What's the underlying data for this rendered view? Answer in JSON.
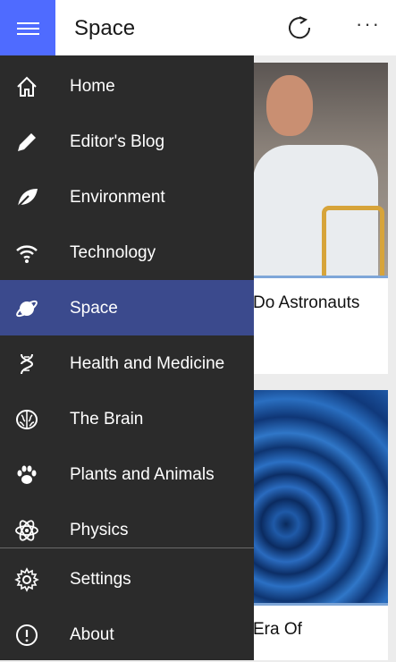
{
  "header": {
    "title": "Space",
    "menu_icon": "hamburger-icon",
    "refresh_icon": "refresh-icon",
    "more_label": "···"
  },
  "content": {
    "cards": [
      {
        "caption": "Do Astronauts"
      },
      {
        "caption": "Era Of"
      }
    ]
  },
  "nav": {
    "items": [
      {
        "label": "Home",
        "icon": "home-icon"
      },
      {
        "label": "Editor's Blog",
        "icon": "pencil-icon"
      },
      {
        "label": "Environment",
        "icon": "leaf-icon"
      },
      {
        "label": "Technology",
        "icon": "wifi-icon"
      },
      {
        "label": "Space",
        "icon": "planet-icon",
        "selected": true
      },
      {
        "label": "Health and Medicine",
        "icon": "dna-icon"
      },
      {
        "label": "The Brain",
        "icon": "brain-icon"
      },
      {
        "label": "Plants and Animals",
        "icon": "paw-icon"
      },
      {
        "label": "Physics",
        "icon": "atom-icon"
      }
    ],
    "footer_items": [
      {
        "label": "Settings",
        "icon": "gear-icon"
      },
      {
        "label": "About",
        "icon": "info-icon"
      }
    ]
  },
  "colors": {
    "accent": "#4f6bff",
    "selected": "#3b4a8d",
    "drawer_bg": "#2b2b2b"
  }
}
